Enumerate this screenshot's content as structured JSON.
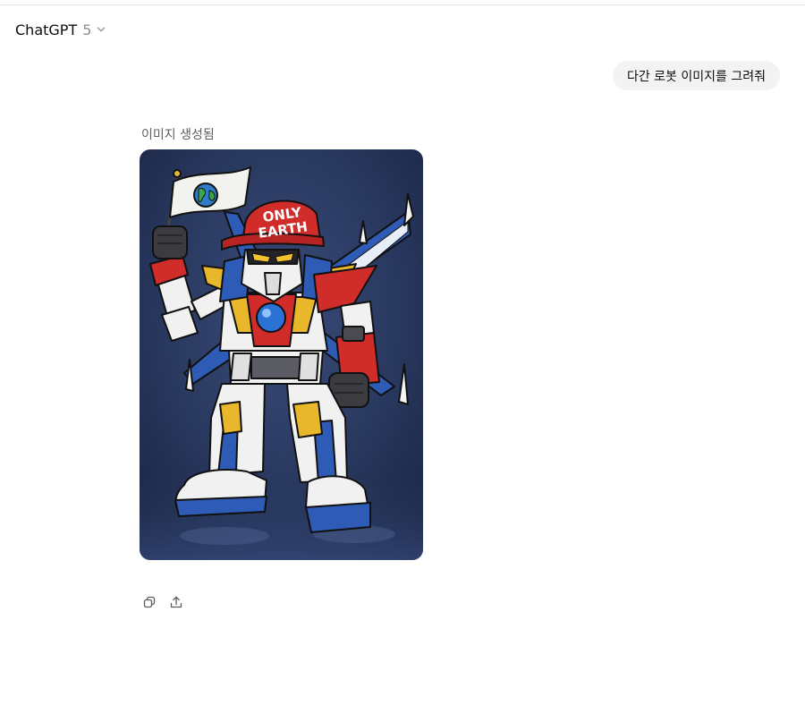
{
  "header": {
    "model_name": "ChatGPT",
    "model_version": "5"
  },
  "conversation": {
    "user_message": "다간 로봇 이미지를 그려줘",
    "assistant": {
      "status_label": "이미지 생성됨",
      "image": {
        "cap_text_line1": "ONLY",
        "cap_text_line2": "EARTH"
      },
      "actions": [
        {
          "icon": "copy-icon"
        },
        {
          "icon": "share-icon"
        }
      ]
    }
  }
}
